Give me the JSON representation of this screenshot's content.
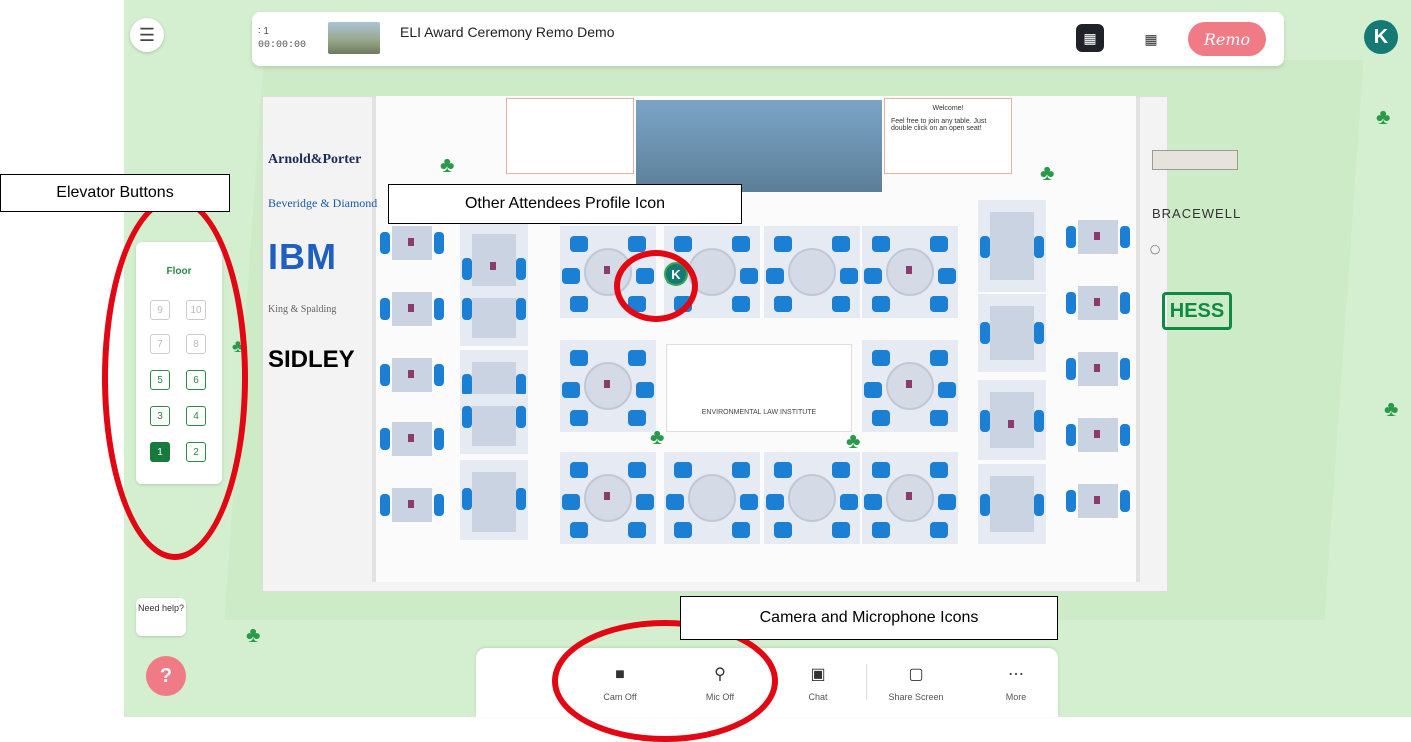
{
  "header": {
    "attendee_count": "∶ 1",
    "timer": "00:00:00",
    "event_title": "ELI Award Ceremony Remo Demo",
    "brand": "Remo",
    "user_initial": "K"
  },
  "floor_plan": {
    "sponsors_left": {
      "arnold": "Arnold&Porter",
      "beveridge": "Beveridge & Diamond",
      "ibm": "IBM",
      "king": "King & Spalding",
      "sidley": "SIDLEY"
    },
    "sponsors_right": {
      "bracewell": "BRACEWELL",
      "hess": "HESS"
    },
    "welcome_title": "Welcome!",
    "welcome_text": "Feel free to join any table. Just double click on an open seat!",
    "center_logo_text": "ENVIRONMENTAL LAW INSTITUTE"
  },
  "elevator": {
    "label": "Floor",
    "buttons": [
      "9",
      "10",
      "7",
      "8",
      "5",
      "6",
      "3",
      "4",
      "1",
      "2"
    ],
    "active": "1"
  },
  "help": {
    "label": "Need help?"
  },
  "toolbar": {
    "cam": "Cam Off",
    "mic": "Mic Off",
    "chat": "Chat",
    "share": "Share Screen",
    "more": "More"
  },
  "annotations": {
    "elevator": "Elevator Buttons",
    "profile": "Other Attendees Profile Icon",
    "cam_mic": "Camera and Microphone Icons"
  },
  "colors": {
    "background": "#d4efcf",
    "accent_green": "#157a3c",
    "chair_blue": "#1b7fd4",
    "brand_pink": "#f07a85",
    "annotation_red": "#e30613"
  }
}
